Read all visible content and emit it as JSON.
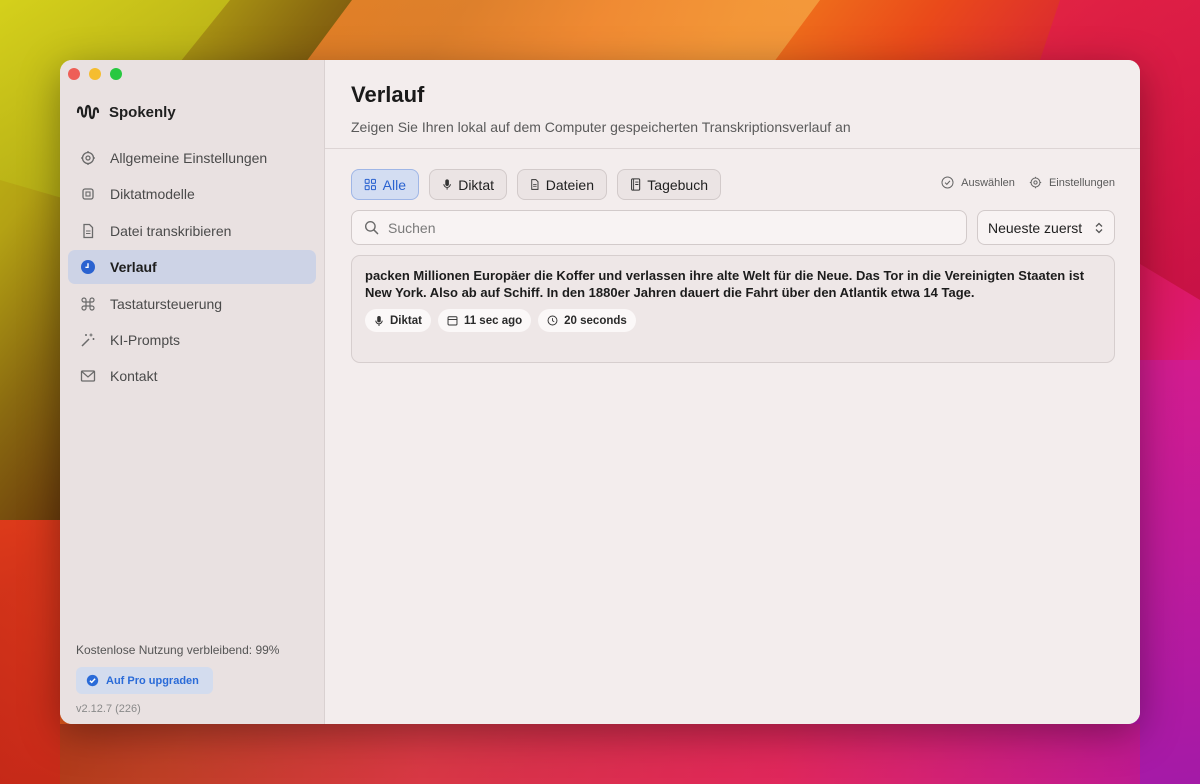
{
  "app": {
    "name": "Spokenly"
  },
  "sidebar": {
    "items": [
      {
        "label": "Allgemeine Einstellungen",
        "icon": "gear-icon"
      },
      {
        "label": "Diktatmodelle",
        "icon": "chip-icon"
      },
      {
        "label": "Datei transkribieren",
        "icon": "document-icon"
      },
      {
        "label": "Verlauf",
        "icon": "clock-icon",
        "active": true
      },
      {
        "label": "Tastatursteuerung",
        "icon": "command-icon"
      },
      {
        "label": "KI-Prompts",
        "icon": "magic-wand-icon"
      },
      {
        "label": "Kontakt",
        "icon": "envelope-icon"
      }
    ],
    "usage": "Kostenlose Nutzung verbleibend: 99%",
    "upgrade_label": "Auf Pro upgraden",
    "version": "v2.12.7 (226)"
  },
  "main": {
    "title": "Verlauf",
    "subtitle": "Zeigen Sie Ihren lokal auf dem Computer gespeicherten Transkriptionsverlauf an",
    "filters": [
      {
        "label": "Alle",
        "active": true
      },
      {
        "label": "Diktat"
      },
      {
        "label": "Dateien"
      },
      {
        "label": "Tagebuch"
      }
    ],
    "actions": {
      "select_label": "Auswählen",
      "settings_label": "Einstellungen"
    },
    "search": {
      "placeholder": "Suchen",
      "value": ""
    },
    "sort": {
      "label": "Neueste zuerst"
    },
    "entries": [
      {
        "text": "packen Millionen Europäer die Koffer und verlassen ihre alte Welt für die Neue. Das Tor in die Vereinigten Staaten ist New York. Also ab auf Schiff. In den 1880er Jahren dauert die Fahrt über den Atlantik etwa 14 Tage.",
        "type": "Diktat",
        "time": "11 sec ago",
        "duration": "20 seconds"
      }
    ]
  },
  "colors": {
    "accent": "#2a62d0",
    "active_nav_bg": "#cdd3e6",
    "window_bg": "#f3eded",
    "sidebar_bg": "#e9e1e1"
  }
}
